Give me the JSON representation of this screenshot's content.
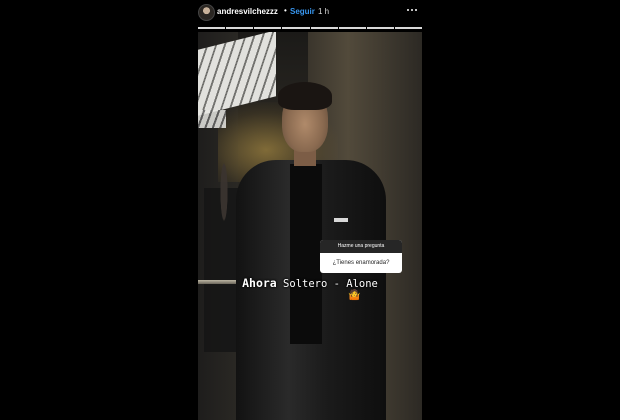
{
  "story": {
    "username": "andresvilchezzz",
    "separator": "•",
    "follow_label": "Seguir",
    "time_ago": "1 h",
    "progress_segments": 8,
    "more_icon": "more-dots-icon",
    "sticker": {
      "header": "Hazme una pregunta",
      "answer": "¿Tienes enamorada?"
    },
    "caption_lead": "Ahora",
    "caption_rest": " Soltero - Alone",
    "caption_emoji": "🤷",
    "accent_color": "#3897f0"
  }
}
